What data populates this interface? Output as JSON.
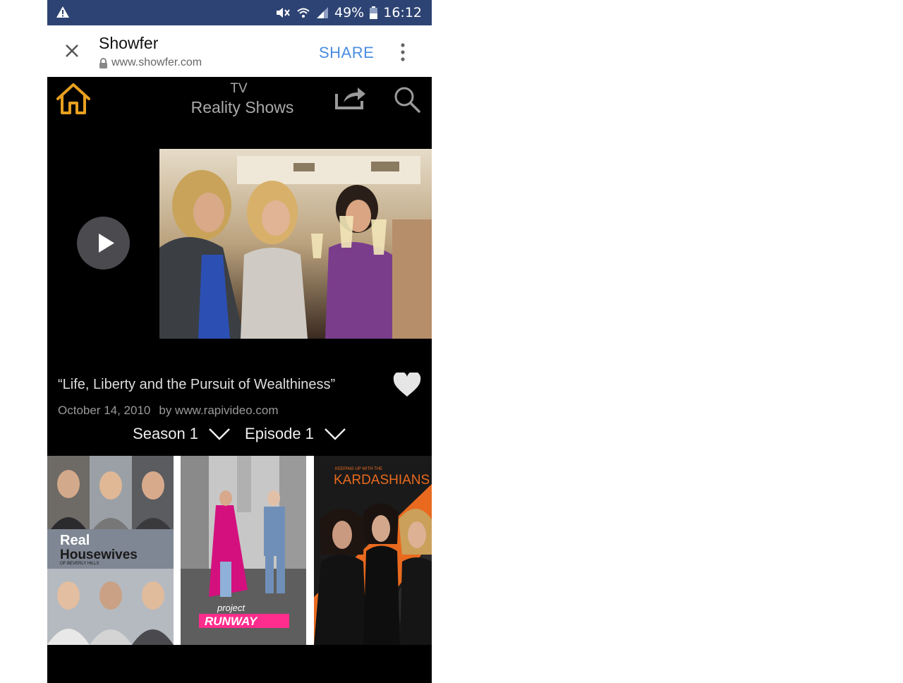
{
  "status_bar": {
    "battery": "49%",
    "time": "16:12",
    "icons": [
      "warning-icon",
      "mute-icon",
      "wifi-icon",
      "signal-icon",
      "battery-icon"
    ]
  },
  "browser": {
    "title": "Showfer",
    "url": "www.showfer.com",
    "share_label": "SHARE"
  },
  "nav": {
    "subtitle": "TV",
    "title": "Reality Shows",
    "accent_color": "#e8a020"
  },
  "episode": {
    "title": "“Life, Liberty and the Pursuit of Wealthiness”",
    "date": "October 14, 2010",
    "source": "by www.rapivideo.com",
    "season_label": "Season 1",
    "episode_label": "Episode 1"
  },
  "shows": [
    {
      "title": "the Real Housewives",
      "subtitle": "OF BEVERLY HILLS"
    },
    {
      "title": "project",
      "subtitle": "RUNWAY"
    },
    {
      "title": "KARDASHIANS",
      "subtitle": "KEEPING UP WITH THE"
    }
  ]
}
